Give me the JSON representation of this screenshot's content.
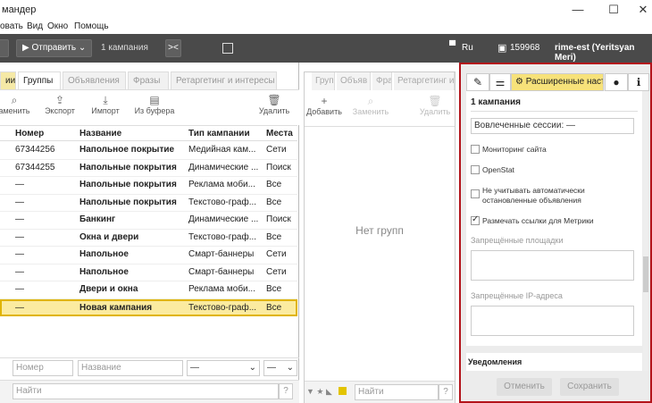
{
  "window": {
    "title": "мандер",
    "controls": {
      "minimize": "—",
      "maximize": "☐",
      "close": "✕"
    }
  },
  "menu": {
    "items": [
      "овать",
      "Вид",
      "Окно",
      "Помощь"
    ]
  },
  "toolbar": {
    "send_label": "Отправить",
    "campaign_count": "1 кампания",
    "lang": "Ru",
    "balance": "159968",
    "user": "rime-est (Yeritsyan Meri)"
  },
  "left_tabs": [
    "ии",
    "Группы",
    "Объявления",
    "Фразы",
    "Ретаргетинг и интересы"
  ],
  "left_actions": [
    {
      "label": "аменить",
      "icon": "search-icon"
    },
    {
      "label": "Экспорт",
      "icon": "export-icon"
    },
    {
      "label": "Импорт",
      "icon": "import-icon"
    },
    {
      "label": "Из буфера",
      "icon": "clipboard-icon"
    },
    {
      "label": "Удалить",
      "icon": "trash-icon"
    }
  ],
  "table": {
    "columns": [
      "Номер",
      "Название",
      "Тип кампании",
      "Места"
    ],
    "rows": [
      {
        "id": "67344256",
        "name": "Напольное покрытие",
        "type": "Медийная кам...",
        "place": "Сети"
      },
      {
        "id": "67344255",
        "name": "Напольные покрытия",
        "type": "Динамические ...",
        "place": "Поиск"
      },
      {
        "id": "—",
        "name": "Напольные покрытия",
        "type": "Реклама моби...",
        "place": "Все"
      },
      {
        "id": "—",
        "name": "Напольные покрытия",
        "type": "Текстово-граф...",
        "place": "Все"
      },
      {
        "id": "—",
        "name": "Банкинг",
        "type": "Динамические ...",
        "place": "Поиск"
      },
      {
        "id": "—",
        "name": "Окна и двери",
        "type": "Текстово-граф...",
        "place": "Все"
      },
      {
        "id": "—",
        "name": "Напольное",
        "type": "Смарт-баннеры",
        "place": "Сети"
      },
      {
        "id": "—",
        "name": "Напольное",
        "type": "Смарт-баннеры",
        "place": "Сети"
      },
      {
        "id": "—",
        "name": "Двери и окна",
        "type": "Реклама моби...",
        "place": "Все"
      },
      {
        "id": "—",
        "name": "Новая кампания",
        "type": "Текстово-граф...",
        "place": "Все"
      }
    ]
  },
  "filters": {
    "number": "Номер",
    "name": "Название",
    "type": "—",
    "place": "—"
  },
  "left_search": {
    "placeholder": "Найти",
    "help": "?"
  },
  "middle": {
    "tabs": [
      "Груп",
      "Объяв",
      "Фра",
      "Ретаргетинг и"
    ],
    "add_label": "Добавить",
    "replace_label": "Заменить",
    "delete_label": "Удалить",
    "empty": "Нет групп",
    "search": "Найти",
    "help": "?"
  },
  "right": {
    "tab_label": "Расширенные наст",
    "section_title": "1 кампания",
    "sessions_value": "Вовлеченные сессии: —",
    "options": [
      {
        "label": "Мониторинг сайта",
        "checked": false
      },
      {
        "label": "OpenStat",
        "checked": false
      },
      {
        "label": "Не учитывать автоматически остановленные объявления",
        "checked": false
      },
      {
        "label": "Размечать ссылки для Метрики",
        "checked": true
      }
    ],
    "forbidden_places_label": "Запрещённые площадки",
    "forbidden_ip_label": "Запрещённые IP-адреса",
    "notifications_label": "Уведомления",
    "cancel_label": "Отменить",
    "save_label": "Сохранить"
  }
}
